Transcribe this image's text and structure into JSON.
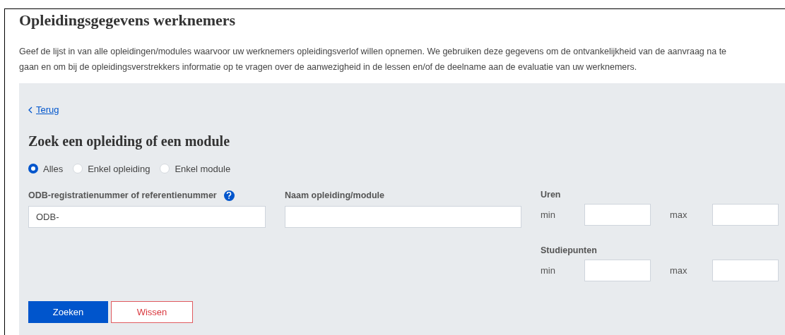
{
  "title": "Opleidingsgegevens werknemers",
  "intro_lines": [
    "Geef de lijst in van alle opleidingen/modules waarvoor uw werknemers opleidingsverlof willen opnemen. We gebruiken deze gegevens om de ontvankelijkheid van de aanvraag na te",
    "gaan en om bij de opleidingsverstrekkers informatie op te vragen over de aanwezigheid in de lessen en/of de deelname aan de evaluatie van uw werknemers."
  ],
  "back_link": "Terug",
  "search": {
    "heading": "Zoek een opleiding of een module",
    "radios": [
      {
        "label": "Alles",
        "selected": true
      },
      {
        "label": "Enkel opleiding",
        "selected": false
      },
      {
        "label": "Enkel module",
        "selected": false
      }
    ],
    "odb_field": {
      "label": "ODB-registratienummer of referentienummer",
      "value": "ODB-"
    },
    "name_field": {
      "label": "Naam opleiding/module"
    },
    "ranges": [
      {
        "label": "Uren",
        "min_label": "min",
        "max_label": "max"
      },
      {
        "label": "Studiepunten",
        "min_label": "min",
        "max_label": "max"
      }
    ],
    "buttons": [
      {
        "label": "Zoeken",
        "kind": "primary"
      },
      {
        "label": "Wissen",
        "kind": "danger"
      }
    ]
  }
}
